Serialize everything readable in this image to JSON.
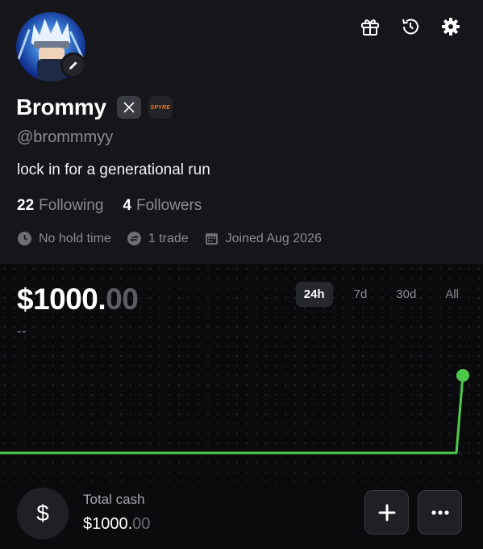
{
  "profile": {
    "display_name": "Brommy",
    "handle": "@brommmyy",
    "bio": "lock in for a generational run",
    "badge_logo_text": "SPYRE",
    "following_count": "22",
    "following_label": "Following",
    "followers_count": "4",
    "followers_label": "Followers",
    "meta": {
      "hold_time": "No hold time",
      "trades": "1 trade",
      "joined": "Joined Aug 2026"
    }
  },
  "header_icons": [
    "gift-icon",
    "history-icon",
    "gear-icon"
  ],
  "portfolio": {
    "balance_main": "$1000.",
    "balance_cents": "00",
    "change": "--",
    "ranges": [
      "24h",
      "7d",
      "30d",
      "All"
    ],
    "selected_range": "24h"
  },
  "chart_data": {
    "type": "line",
    "series": [
      {
        "values": [
          0,
          0,
          0,
          0,
          0,
          0,
          0,
          0,
          0,
          0,
          0,
          0,
          0.85
        ]
      }
    ],
    "color": "#4cc94c"
  },
  "cash": {
    "label": "Total cash",
    "value_main": "$1000.",
    "value_cents": "00",
    "icon": "$"
  },
  "colors": {
    "accent_green": "#4cc94c",
    "background": "#0b0b0e",
    "panel": "#15151a",
    "muted_text": "#8b8b93"
  }
}
